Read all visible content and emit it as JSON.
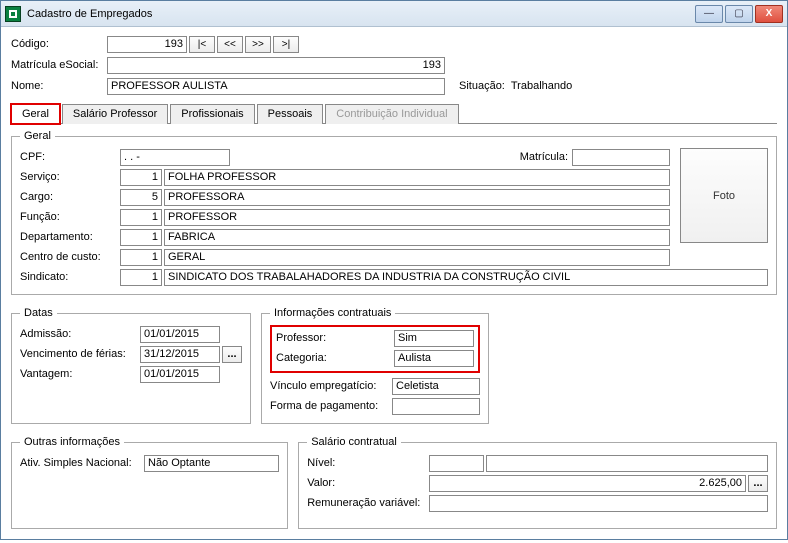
{
  "titlebar": {
    "title": "Cadastro de Empregados"
  },
  "header": {
    "codigo_label": "Código:",
    "codigo_value": "193",
    "nav_first": "|<",
    "nav_prev": "<<",
    "nav_next": ">>",
    "nav_last": ">|",
    "matricula_esocial_label": "Matrícula eSocial:",
    "matricula_esocial_value": "193",
    "nome_label": "Nome:",
    "nome_value": "PROFESSOR AULISTA",
    "situacao_label": "Situação:",
    "situacao_value": "Trabalhando"
  },
  "tabs": {
    "geral": "Geral",
    "salario_professor": "Salário Professor",
    "profissionais": "Profissionais",
    "pessoais": "Pessoais",
    "contribuicao_individual": "Contribuição Individual"
  },
  "geral": {
    "legend": "Geral",
    "cpf_label": "CPF:",
    "cpf_value": " .   .   -  ",
    "matricula_label": "Matrícula:",
    "matricula_value": "",
    "servico_label": "Serviço:",
    "servico_code": "1",
    "servico_desc": "FOLHA PROFESSOR",
    "cargo_label": "Cargo:",
    "cargo_code": "5",
    "cargo_desc": "PROFESSORA",
    "funcao_label": "Função:",
    "funcao_code": "1",
    "funcao_desc": "PROFESSOR",
    "departamento_label": "Departamento:",
    "departamento_code": "1",
    "departamento_desc": "FABRICA",
    "centrocusto_label": "Centro de custo:",
    "centrocusto_code": "1",
    "centrocusto_desc": "GERAL",
    "sindicato_label": "Sindicato:",
    "sindicato_code": "1",
    "sindicato_desc": "SINDICATO DOS TRABALAHADORES DA INDUSTRIA DA CONSTRUÇÃO CIVIL",
    "foto_label": "Foto"
  },
  "datas": {
    "legend": "Datas",
    "admissao_label": "Admissão:",
    "admissao_value": "01/01/2015",
    "vencimento_ferias_label": "Vencimento de férias:",
    "vencimento_ferias_value": "31/12/2015",
    "vantagem_label": "Vantagem:",
    "vantagem_value": "01/01/2015"
  },
  "infocontratuais": {
    "legend": "Informações contratuais",
    "professor_label": "Professor:",
    "professor_value": "Sim",
    "categoria_label": "Categoria:",
    "categoria_value": "Aulista",
    "vinculo_label": "Vínculo empregatício:",
    "vinculo_value": "Celetista",
    "formapagto_label": "Forma de pagamento:",
    "formapagto_value": ""
  },
  "outras": {
    "legend": "Outras informações",
    "ativ_simples_label": "Ativ. Simples Nacional:",
    "ativ_simples_value": "Não Optante"
  },
  "salario": {
    "legend": "Salário contratual",
    "nivel_label": "Nível:",
    "nivel_code": "",
    "nivel_desc": "",
    "valor_label": "Valor:",
    "valor_value": "2.625,00",
    "remuneracao_label": "Remuneração variável:",
    "remuneracao_value": ""
  },
  "misc": {
    "ellipsis": "..."
  }
}
